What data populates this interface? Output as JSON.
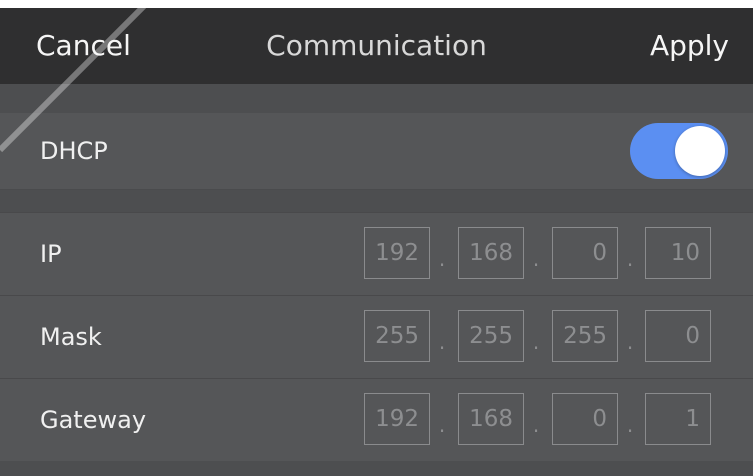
{
  "header": {
    "cancel_label": "Cancel",
    "title": "Communication",
    "apply_label": "Apply"
  },
  "dhcp": {
    "label": "DHCP",
    "enabled": true,
    "toggle_color": "#5b8ff2"
  },
  "network": {
    "ip": {
      "label": "IP",
      "octets": [
        "192",
        "168",
        "0",
        "10"
      ]
    },
    "mask": {
      "label": "Mask",
      "octets": [
        "255",
        "255",
        "255",
        "0"
      ]
    },
    "gateway": {
      "label": "Gateway",
      "octets": [
        "192",
        "168",
        "0",
        "1"
      ]
    }
  }
}
